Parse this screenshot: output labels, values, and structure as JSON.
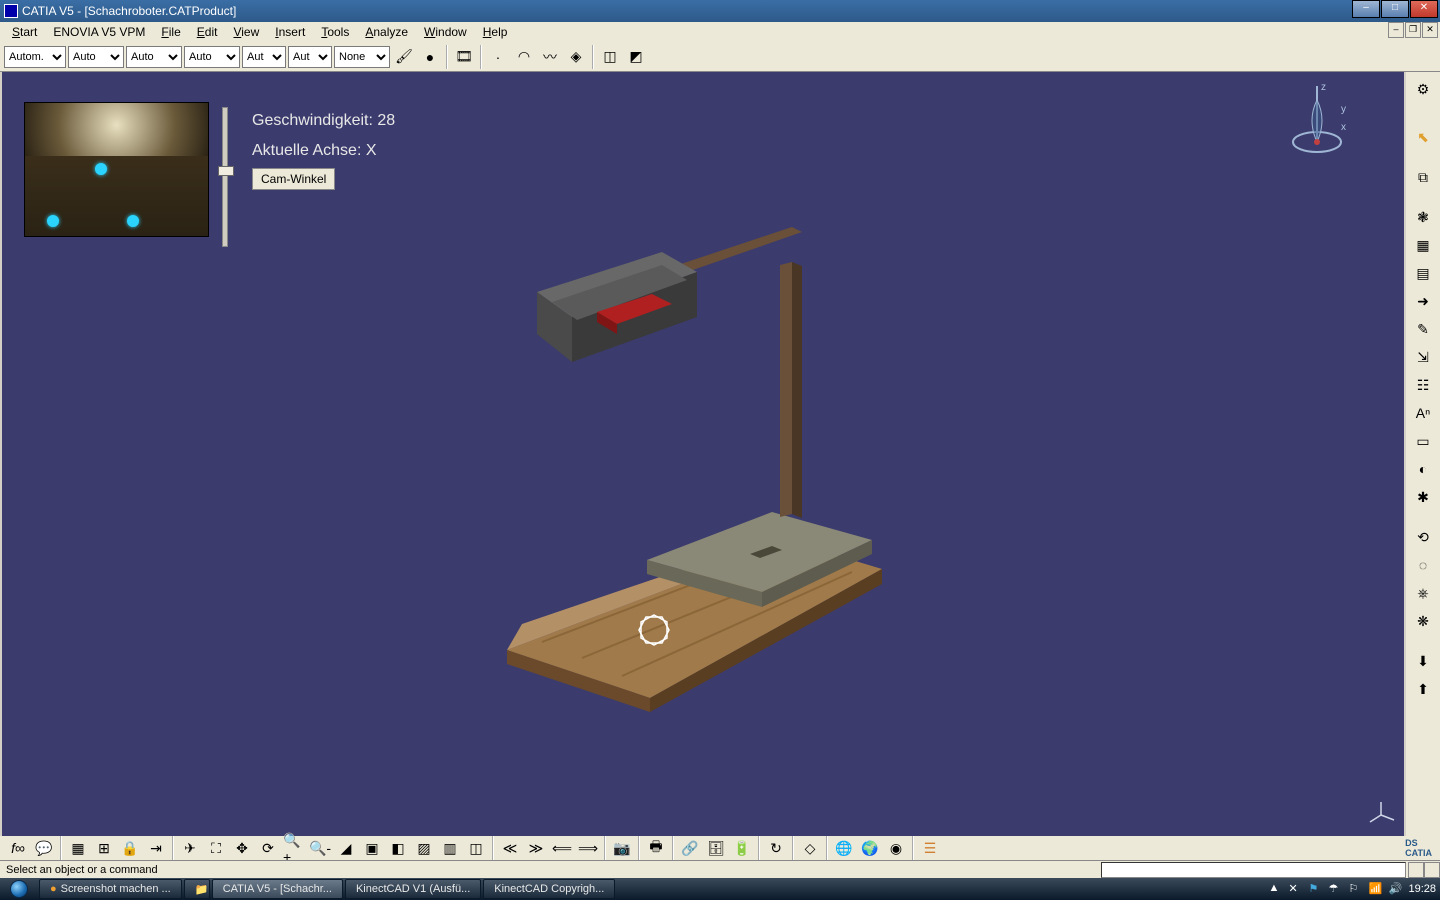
{
  "window": {
    "title": "CATIA V5 - [Schachroboter.CATProduct]"
  },
  "menubar": {
    "start": "Start",
    "enovia": "ENOVIA V5 VPM",
    "file": "File",
    "edit": "Edit",
    "view": "View",
    "insert": "Insert",
    "tools": "Tools",
    "analyze": "Analyze",
    "window": "Window",
    "help": "Help"
  },
  "toolbar_combos": {
    "c1": "Autom.",
    "c2": "Auto",
    "c3": "Auto",
    "c4": "Auto",
    "c5": "Aut",
    "c6": "Aut",
    "c7": "None"
  },
  "overlay": {
    "speed_label": "Geschwindigkeit: 28",
    "axis_label": "Aktuelle Achse: X",
    "cam_button": "Cam-Winkel"
  },
  "compass": {
    "z": "z",
    "y": "y",
    "x": "x"
  },
  "status": {
    "prompt": "Select an object or a command"
  },
  "taskbar": {
    "items": [
      "Screenshot machen ...",
      "",
      "CATIA V5 - [Schachr...",
      "KinectCAD V1 (Ausfü...",
      "KinectCAD Copyrigh..."
    ],
    "clock": "19:28"
  }
}
